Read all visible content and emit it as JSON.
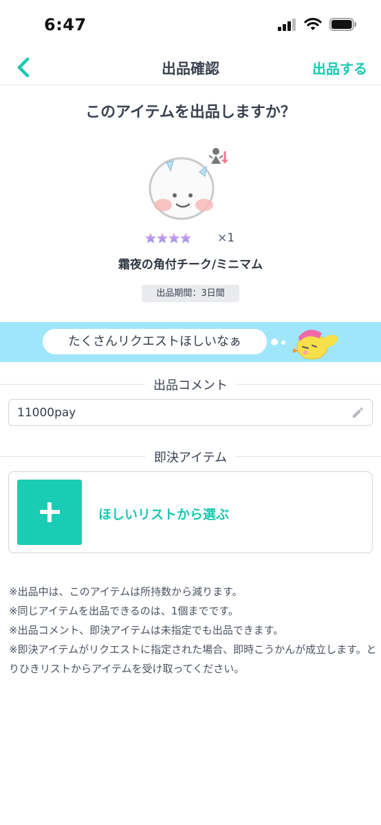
{
  "status_bar": {
    "time": "6:47",
    "icons": [
      "signal-icon",
      "wifi-icon",
      "battery-icon"
    ]
  },
  "nav": {
    "back_icon": "chevron-left-icon",
    "title": "出品確認",
    "action_label": "出品する"
  },
  "confirm": {
    "question": "このアイテムを出品しますか？"
  },
  "item": {
    "image": "face-cheek-illustration",
    "rarity_stars": 4,
    "quantity": "×1",
    "name": "霜夜の角付チーク/ミニマム",
    "period": "出品期間：3日間"
  },
  "banner": {
    "text": "たくさんリクエストほしいなぁ",
    "mascot": "pink-cap-bird-mascot"
  },
  "comment_section": {
    "title": "出品コメント",
    "value": "11000pay",
    "edit_icon": "pencil-icon"
  },
  "instant_section": {
    "title": "即決アイテム",
    "button_label": "ほしいリストから選ぶ",
    "add_icon": "plus-icon"
  },
  "notes": [
    "※出品中は、このアイテムは所持数から減ります。",
    "※同じアイテムを出品できるのは、1個までです。",
    "※出品コメント、即決アイテムは未指定でも出品できます。",
    "※即決アイテムがリクエストに指定された場合、即時こうかんが成立します。とりひきリストからアイテムを受け取ってください。"
  ],
  "colors": {
    "accent": "#18c9b0",
    "banner": "#9fe6fa",
    "text": "#3a4250"
  }
}
